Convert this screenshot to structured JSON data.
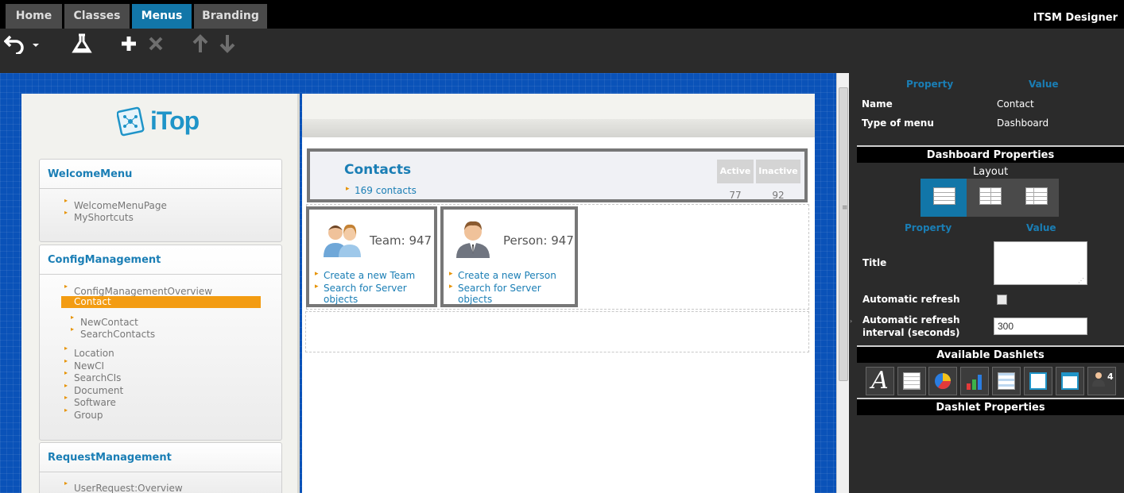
{
  "tabs": [
    "Home",
    "Classes",
    "Menus",
    "Branding"
  ],
  "active_tab": "Menus",
  "app_title": "ITSM Designer",
  "toolbar": {
    "undo_icon": "undo-icon",
    "undo_dropdown_icon": "caret-down-icon",
    "test_icon": "flask-icon",
    "add_icon": "plus-icon",
    "delete_icon": "close-icon",
    "up_icon": "arrow-up-icon",
    "down_icon": "arrow-down-icon"
  },
  "itop": {
    "logo_text": "iTop",
    "menus": [
      {
        "title": "WelcomeMenu",
        "items": [
          "WelcomeMenuPage",
          "MyShortcuts"
        ]
      },
      {
        "title": "ConfigManagement",
        "items": [
          "ConfigManagementOverview",
          "Contact",
          "NewContact",
          "SearchContacts",
          "Location",
          "NewCI",
          "SearchCIs",
          "Document",
          "Software",
          "Group"
        ],
        "selected": "Contact"
      },
      {
        "title": "RequestManagement",
        "items": [
          "UserRequest:Overview"
        ]
      }
    ],
    "dashboard": {
      "title": "Contacts",
      "link": "169 contacts",
      "stats": [
        {
          "label": "Active",
          "value": "77"
        },
        {
          "label": "Inactive",
          "value": "92"
        }
      ],
      "cards": [
        {
          "count_label": "Team: 947",
          "links": [
            "Create a new Team",
            "Search for Server objects"
          ]
        },
        {
          "count_label": "Person: 947",
          "links": [
            "Create a new Person",
            "Search for Server objects"
          ]
        }
      ]
    }
  },
  "properties": {
    "col_property": "Property",
    "col_value": "Value",
    "rows": [
      {
        "label": "Name",
        "value": "Contact"
      },
      {
        "label": "Type of menu",
        "value": "Dashboard"
      }
    ]
  },
  "dashboard_properties": {
    "title": "Dashboard Properties",
    "layout_label": "Layout",
    "col_property": "Property",
    "col_value": "Value",
    "title_label": "Title",
    "title_value": "",
    "auto_refresh_label": "Automatic refresh",
    "auto_refresh_checked": false,
    "interval_label_1": "Automatic refresh",
    "interval_label_2": "interval (seconds)",
    "interval_value": "300"
  },
  "available_dashlets": {
    "title": "Available Dashlets",
    "items": [
      "text-dashlet-icon",
      "table-dashlet-icon",
      "pie-chart-icon",
      "bar-chart-icon",
      "list-dashlet-icon",
      "header-dashlet-icon",
      "header-static-icon",
      "badge-dashlet-icon"
    ],
    "badge_count": "4"
  },
  "dashlet_properties": {
    "title": "Dashlet Properties"
  }
}
